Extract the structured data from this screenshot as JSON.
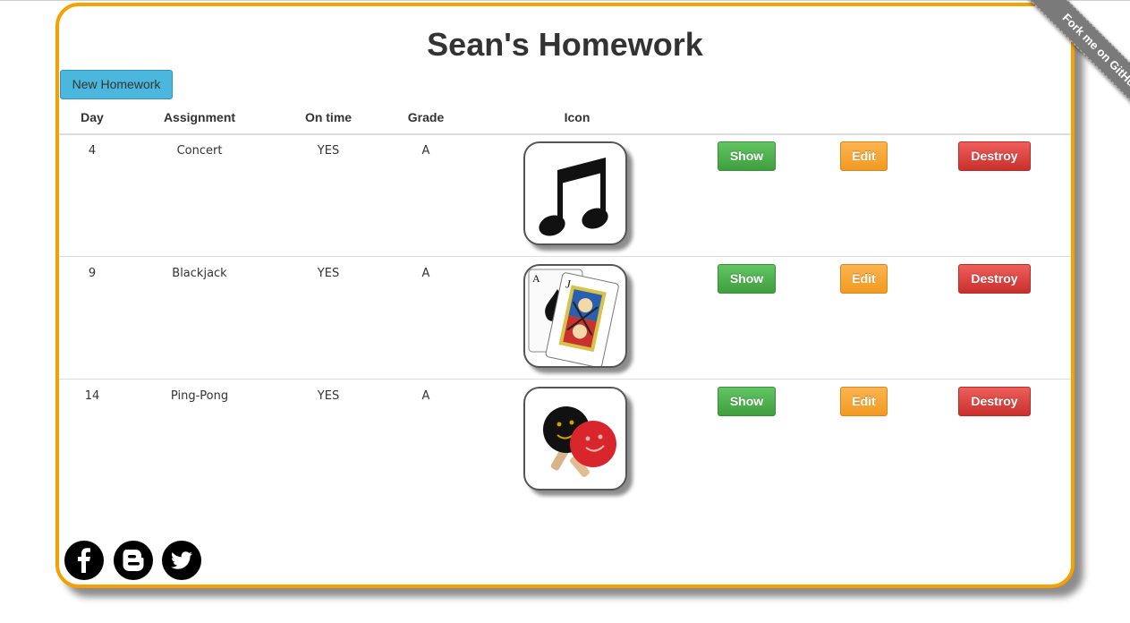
{
  "page": {
    "title": "Sean's Homework"
  },
  "toolbar": {
    "new_label": "New Homework"
  },
  "table": {
    "headers": {
      "day": "Day",
      "assignment": "Assignment",
      "on_time": "On time",
      "grade": "Grade",
      "icon": "Icon"
    },
    "rows": [
      {
        "day": "4",
        "assignment": "Concert",
        "on_time": "YES",
        "grade": "A",
        "icon": "music-note-icon"
      },
      {
        "day": "9",
        "assignment": "Blackjack",
        "on_time": "YES",
        "grade": "A",
        "icon": "playing-cards-icon"
      },
      {
        "day": "14",
        "assignment": "Ping-Pong",
        "on_time": "YES",
        "grade": "A",
        "icon": "ping-pong-paddles-icon"
      }
    ],
    "actions": {
      "show": "Show",
      "edit": "Edit",
      "destroy": "Destroy"
    }
  },
  "ribbon": {
    "label": "Fork me on GitHub"
  },
  "social": [
    {
      "icon": "facebook-icon"
    },
    {
      "icon": "blogger-icon"
    },
    {
      "icon": "twitter-icon"
    }
  ],
  "colors": {
    "border": "#f5a100",
    "new_button": "#4bb7dc",
    "show_button": "#5bb75b",
    "edit_button": "#f2a03a",
    "destroy_button": "#da4f49"
  }
}
